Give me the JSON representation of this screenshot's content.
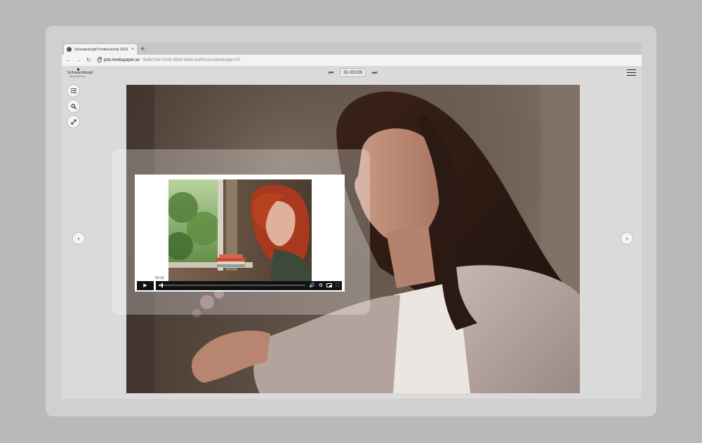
{
  "browser": {
    "tab_title": "Schwarzkopf Professional 2021",
    "tab_close": "×",
    "new_tab": "+",
    "url_host": "pub.mediapaper.se",
    "url_path": "/5e8cf18e-0316-45d5-b56a-aa5f0a1ccbeb#page=33",
    "back": "←",
    "forward": "→",
    "reload": "↻"
  },
  "viewer": {
    "logo_text": "Schwarzkopf",
    "logo_sub": "PROFESSIONAL",
    "pager": {
      "first": "⏮",
      "page_indicator": "32-33/156",
      "last": "⏭"
    },
    "tools": {
      "toc_icon": "list-icon",
      "search_icon": "search-icon",
      "fullscreen_icon": "expand-icon"
    },
    "prev": "‹",
    "next": "›"
  },
  "video": {
    "time_tooltip": "01:10",
    "play": "▶",
    "progress": 0.02,
    "volume": "🔊",
    "settings": "⚙",
    "fullscreen": "⛶"
  }
}
